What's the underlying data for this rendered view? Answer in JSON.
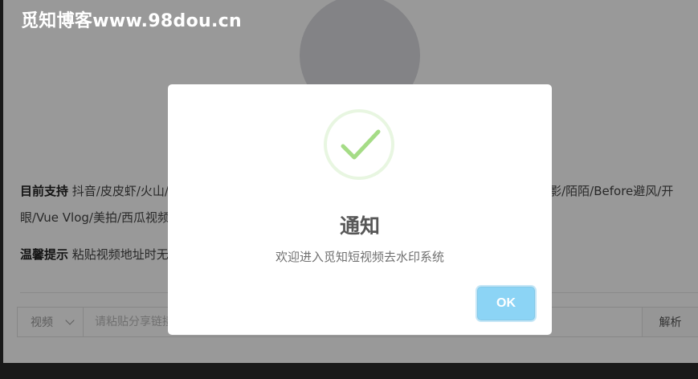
{
  "watermark": "觅知博客www.98dou.cn",
  "background": {
    "support_label": "目前支持",
    "support_text": "抖音/皮皮虾/火山/微视/快手/最右/小咖秀/晃咖/全民小视频/陌陌/皮皮搞笑/全民k歌/巴塞电影/陌陌/Before避风/开眼/Vue Vlog/美拍/西瓜视频/今日头条/好看视频",
    "tips_label": "温馨提示",
    "tips_text": "粘贴视频地址时无需删除文案，系统会自动识别视频链接",
    "type_select": "视频",
    "url_placeholder": "请粘贴分享链接",
    "parse_button": "解析"
  },
  "modal": {
    "icon": "checkmark-icon",
    "title": "通知",
    "text": "欢迎进入觅知短视频去水印系统",
    "ok_label": "OK"
  },
  "colors": {
    "success": "#a5dc86",
    "ok_button": "#8cd4f5"
  }
}
